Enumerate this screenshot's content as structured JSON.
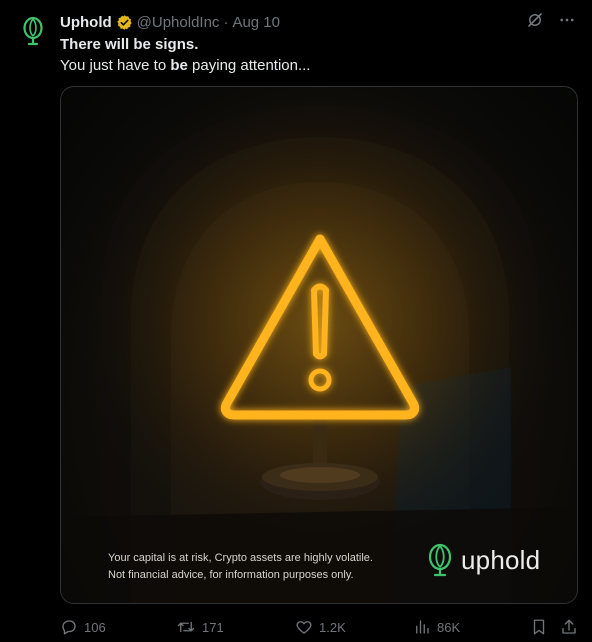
{
  "author": {
    "name": "Uphold",
    "handle": "@UpholdInc",
    "date": "Aug 10"
  },
  "tweet": {
    "line1": "There will be signs.",
    "line2_pre": "You just have to ",
    "line2_bold": "be",
    "line2_post": " paying attention..."
  },
  "media": {
    "disclaimer_line1": "Your capital is at risk, Crypto assets are highly volatile.",
    "disclaimer_line2": "Not financial advice, for information purposes only.",
    "brand_name": "uphold"
  },
  "metrics": {
    "replies": "106",
    "reposts": "171",
    "likes": "1.2K",
    "views": "86K"
  },
  "icons": {
    "avatar": "uphold-logo-icon",
    "verified": "verified-badge-icon",
    "grok": "grok-icon",
    "more": "more-icon",
    "reply": "reply-icon",
    "repost": "repost-icon",
    "like": "heart-icon",
    "views": "views-icon",
    "bookmark": "bookmark-icon",
    "share": "share-icon"
  },
  "colors": {
    "brand_green": "#3ec46d",
    "verified_gold": "#e2b719",
    "neon_orange": "#ffb31a",
    "muted": "#71767b"
  }
}
